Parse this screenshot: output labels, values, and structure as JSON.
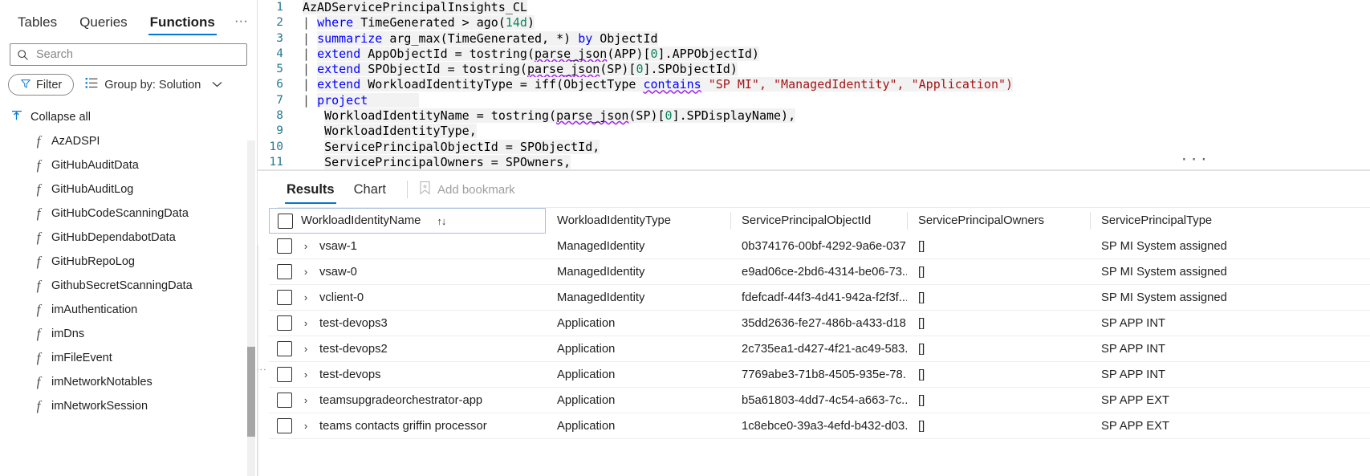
{
  "sidebar": {
    "tabs": [
      {
        "label": "Tables",
        "active": false
      },
      {
        "label": "Queries",
        "active": false
      },
      {
        "label": "Functions",
        "active": true
      }
    ],
    "more_label": "···",
    "collapse_chevron": "«",
    "search": {
      "placeholder": "Search",
      "value": "",
      "icon": "search-icon"
    },
    "filter_button": {
      "label": "Filter",
      "icon": "filter-icon"
    },
    "group_by": {
      "label": "Group by: Solution",
      "icon": "list-icon",
      "chevron": "∨"
    },
    "collapse_all": {
      "label": "Collapse all",
      "icon": "collapse-all-icon"
    },
    "functions": [
      {
        "label": "AzADSPI"
      },
      {
        "label": "GitHubAuditData"
      },
      {
        "label": "GitHubAuditLog"
      },
      {
        "label": "GitHubCodeScanningData"
      },
      {
        "label": "GitHubDependabotData"
      },
      {
        "label": "GitHubRepoLog"
      },
      {
        "label": "GithubSecretScanningData"
      },
      {
        "label": "imAuthentication"
      },
      {
        "label": "imDns"
      },
      {
        "label": "imFileEvent"
      },
      {
        "label": "imNetworkNotables"
      },
      {
        "label": "imNetworkSession"
      }
    ]
  },
  "editor": {
    "overflow_dots": "···",
    "lines": [
      {
        "n": "1",
        "text": "AzADServicePrincipalInsights_CL"
      },
      {
        "n": "2",
        "text": "| where TimeGenerated > ago(14d)"
      },
      {
        "n": "3",
        "text": "| summarize arg_max(TimeGenerated, *) by ObjectId"
      },
      {
        "n": "4",
        "text": "| extend AppObjectId = tostring(parse_json(APP)[0].APPObjectId)"
      },
      {
        "n": "5",
        "text": "| extend SPObjectId = tostring(parse_json(SP)[0].SPObjectId)"
      },
      {
        "n": "6",
        "text": "| extend WorkloadIdentityType = iff(ObjectType contains \"SP MI\", \"ManagedIdentity\", \"Application\")"
      },
      {
        "n": "7",
        "text": "| project"
      },
      {
        "n": "8",
        "text": "    WorkloadIdentityName = tostring(parse_json(SP)[0].SPDisplayName),"
      },
      {
        "n": "9",
        "text": "    WorkloadIdentityType,"
      },
      {
        "n": "10",
        "text": "    ServicePrincipalObjectId = SPObjectId,"
      },
      {
        "n": "11",
        "text": "    ServicePrincipalOwners = SPOwners,"
      }
    ]
  },
  "results": {
    "tabs": [
      {
        "label": "Results",
        "active": true
      },
      {
        "label": "Chart",
        "active": false
      }
    ],
    "add_bookmark": {
      "label": "Add bookmark",
      "icon": "bookmark-icon"
    },
    "table": {
      "columns": [
        {
          "label": "WorkloadIdentityName",
          "sorted": true,
          "sort_glyph": "↑↓"
        },
        {
          "label": "WorkloadIdentityType",
          "sorted": false
        },
        {
          "label": "ServicePrincipalObjectId",
          "sorted": false
        },
        {
          "label": "ServicePrincipalOwners",
          "sorted": false
        },
        {
          "label": "ServicePrincipalType",
          "sorted": false
        }
      ],
      "rows": [
        {
          "WorkloadIdentityName": "vsaw-1",
          "WorkloadIdentityType": "ManagedIdentity",
          "ServicePrincipalObjectId": "0b374176-00bf-4292-9a6e-037...",
          "ServicePrincipalOwners": "[]",
          "ServicePrincipalType": "SP MI System assigned"
        },
        {
          "WorkloadIdentityName": "vsaw-0",
          "WorkloadIdentityType": "ManagedIdentity",
          "ServicePrincipalObjectId": "e9ad06ce-2bd6-4314-be06-73...",
          "ServicePrincipalOwners": "[]",
          "ServicePrincipalType": "SP MI System assigned"
        },
        {
          "WorkloadIdentityName": "vclient-0",
          "WorkloadIdentityType": "ManagedIdentity",
          "ServicePrincipalObjectId": "fdefcadf-44f3-4d41-942a-f2f3f...",
          "ServicePrincipalOwners": "[]",
          "ServicePrincipalType": "SP MI System assigned"
        },
        {
          "WorkloadIdentityName": "test-devops3",
          "WorkloadIdentityType": "Application",
          "ServicePrincipalObjectId": "35dd2636-fe27-486b-a433-d18...",
          "ServicePrincipalOwners": "[]",
          "ServicePrincipalType": "SP APP INT"
        },
        {
          "WorkloadIdentityName": "test-devops2",
          "WorkloadIdentityType": "Application",
          "ServicePrincipalObjectId": "2c735ea1-d427-4f21-ac49-583...",
          "ServicePrincipalOwners": "[]",
          "ServicePrincipalType": "SP APP INT"
        },
        {
          "WorkloadIdentityName": "test-devops",
          "WorkloadIdentityType": "Application",
          "ServicePrincipalObjectId": "7769abe3-71b8-4505-935e-78...",
          "ServicePrincipalOwners": "[]",
          "ServicePrincipalType": "SP APP INT"
        },
        {
          "WorkloadIdentityName": "teamsupgradeorchestrator-app",
          "WorkloadIdentityType": "Application",
          "ServicePrincipalObjectId": "b5a61803-4dd7-4c54-a663-7c...",
          "ServicePrincipalOwners": "[]",
          "ServicePrincipalType": "SP APP EXT"
        },
        {
          "WorkloadIdentityName": "teams contacts griffin processor",
          "WorkloadIdentityType": "Application",
          "ServicePrincipalObjectId": "1c8ebce0-39a3-4efd-b432-d03...",
          "ServicePrincipalOwners": "[]",
          "ServicePrincipalType": "SP APP EXT"
        }
      ]
    }
  },
  "colors": {
    "accent": "#0078d4",
    "keyword": "#0000ff",
    "string": "#a31515",
    "number": "#098658",
    "linenumber": "#237893",
    "border": "#e1dfdd"
  }
}
